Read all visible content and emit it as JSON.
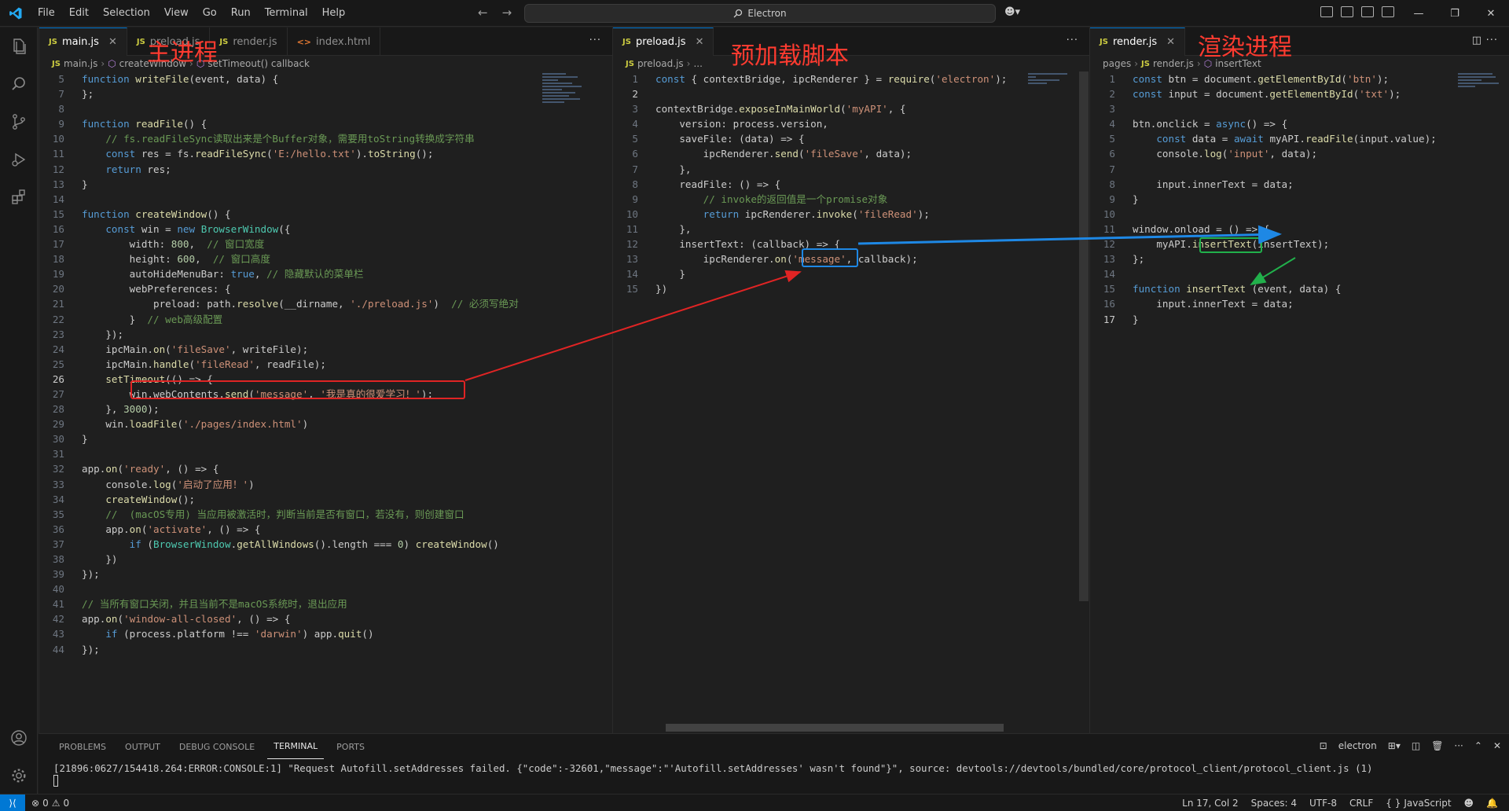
{
  "menu": [
    "File",
    "Edit",
    "Selection",
    "View",
    "Go",
    "Run",
    "Terminal",
    "Help"
  ],
  "search": {
    "text": "Electron"
  },
  "groups": {
    "left": {
      "tabs": [
        "main.js",
        "preload.js",
        "render.js",
        "index.html"
      ],
      "breadcrumb": [
        "main.js",
        "createWindow",
        "setTimeout() callback"
      ],
      "annotation": "主进程"
    },
    "mid": {
      "tabs": [
        "preload.js"
      ],
      "breadcrumb": [
        "preload.js",
        "..."
      ],
      "annotation": "预加载脚本"
    },
    "right": {
      "tabs": [
        "render.js"
      ],
      "breadcrumb": [
        "pages",
        "render.js",
        "insertText"
      ],
      "annotation": "渲染进程"
    }
  },
  "code": {
    "main": [
      {
        "n": 5,
        "t": "function writeFile(event, data) {"
      },
      {
        "n": 7,
        "t": "};"
      },
      {
        "n": 8,
        "t": ""
      },
      {
        "n": 9,
        "t": "function readFile() {"
      },
      {
        "n": 10,
        "t": "    // fs.readFileSync读取出来是个Buffer对象，需要用toString转换成字符串"
      },
      {
        "n": 11,
        "t": "    const res = fs.readFileSync('E:/hello.txt').toString();"
      },
      {
        "n": 12,
        "t": "    return res;"
      },
      {
        "n": 13,
        "t": "}"
      },
      {
        "n": 14,
        "t": ""
      },
      {
        "n": 15,
        "t": "function createWindow() {"
      },
      {
        "n": 16,
        "t": "    const win = new BrowserWindow({"
      },
      {
        "n": 17,
        "t": "        width: 800,  // 窗口宽度"
      },
      {
        "n": 18,
        "t": "        height: 600,  // 窗口高度"
      },
      {
        "n": 19,
        "t": "        autoHideMenuBar: true, // 隐藏默认的菜单栏"
      },
      {
        "n": 20,
        "t": "        webPreferences: {"
      },
      {
        "n": 21,
        "t": "            preload: path.resolve(__dirname, './preload.js')  // 必须写绝对"
      },
      {
        "n": 22,
        "t": "        }  // web高级配置"
      },
      {
        "n": 23,
        "t": "    });"
      },
      {
        "n": 24,
        "t": "    ipcMain.on('fileSave', writeFile);"
      },
      {
        "n": 25,
        "t": "    ipcMain.handle('fileRead', readFile);"
      },
      {
        "n": 26,
        "t": "    setTimeout(() => {"
      },
      {
        "n": 27,
        "t": "        win.webContents.send('message', '我是真的很爱学习！');"
      },
      {
        "n": 28,
        "t": "    }, 3000);"
      },
      {
        "n": 29,
        "t": "    win.loadFile('./pages/index.html')"
      },
      {
        "n": 30,
        "t": "}"
      },
      {
        "n": 31,
        "t": ""
      },
      {
        "n": 32,
        "t": "app.on('ready', () => {"
      },
      {
        "n": 33,
        "t": "    console.log('启动了应用！')"
      },
      {
        "n": 34,
        "t": "    createWindow();"
      },
      {
        "n": 35,
        "t": "    //  (macOS专用) 当应用被激活时，判断当前是否有窗口，若没有，则创建窗口"
      },
      {
        "n": 36,
        "t": "    app.on('activate', () => {"
      },
      {
        "n": 37,
        "t": "        if (BrowserWindow.getAllWindows().length === 0) createWindow()"
      },
      {
        "n": 38,
        "t": "    })"
      },
      {
        "n": 39,
        "t": "});"
      },
      {
        "n": 40,
        "t": ""
      },
      {
        "n": 41,
        "t": "// 当所有窗口关闭，并且当前不是macOS系统时，退出应用"
      },
      {
        "n": 42,
        "t": "app.on('window-all-closed', () => {"
      },
      {
        "n": 43,
        "t": "    if (process.platform !== 'darwin') app.quit()"
      },
      {
        "n": 44,
        "t": "});"
      }
    ],
    "preload": [
      {
        "n": 1,
        "t": "const { contextBridge, ipcRenderer } = require('electron');"
      },
      {
        "n": 2,
        "t": ""
      },
      {
        "n": 3,
        "t": "contextBridge.exposeInMainWorld('myAPI', {"
      },
      {
        "n": 4,
        "t": "    version: process.version,"
      },
      {
        "n": 5,
        "t": "    saveFile: (data) => {"
      },
      {
        "n": 6,
        "t": "        ipcRenderer.send('fileSave', data);"
      },
      {
        "n": 7,
        "t": "    },"
      },
      {
        "n": 8,
        "t": "    readFile: () => {"
      },
      {
        "n": 9,
        "t": "        // invoke的返回值是一个promise对象"
      },
      {
        "n": 10,
        "t": "        return ipcRenderer.invoke('fileRead');"
      },
      {
        "n": 11,
        "t": "    },"
      },
      {
        "n": 12,
        "t": "    insertText: (callback) => {"
      },
      {
        "n": 13,
        "t": "        ipcRenderer.on('message', callback);"
      },
      {
        "n": 14,
        "t": "    }"
      },
      {
        "n": 15,
        "t": "})"
      }
    ],
    "render": [
      {
        "n": 1,
        "t": "const btn = document.getElementById('btn');"
      },
      {
        "n": 2,
        "t": "const input = document.getElementById('txt');"
      },
      {
        "n": 3,
        "t": ""
      },
      {
        "n": 4,
        "t": "btn.onclick = async() => {"
      },
      {
        "n": 5,
        "t": "    const data = await myAPI.readFile(input.value);"
      },
      {
        "n": 6,
        "t": "    console.log('input', data);"
      },
      {
        "n": 7,
        "t": ""
      },
      {
        "n": 8,
        "t": "    input.innerText = data;"
      },
      {
        "n": 9,
        "t": "}"
      },
      {
        "n": 10,
        "t": ""
      },
      {
        "n": 11,
        "t": "window.onload = () => {"
      },
      {
        "n": 12,
        "t": "    myAPI.insertText(insertText);"
      },
      {
        "n": 13,
        "t": "};"
      },
      {
        "n": 14,
        "t": ""
      },
      {
        "n": 15,
        "t": "function insertText (event, data) {"
      },
      {
        "n": 16,
        "t": "    input.innerText = data;"
      },
      {
        "n": 17,
        "t": "}"
      }
    ]
  },
  "panel": {
    "tabs": [
      "PROBLEMS",
      "OUTPUT",
      "DEBUG CONSOLE",
      "TERMINAL",
      "PORTS"
    ],
    "active_tab": "TERMINAL",
    "terminal_name": "electron",
    "terminal_output": "[21896:0627/154418.264:ERROR:CONSOLE:1] \"Request Autofill.setAddresses failed. {\"code\":-32601,\"message\":\"'Autofill.setAddresses' wasn't found\"}\", source: devtools://devtools/bundled/core/protocol_client/protocol_client.js (1)"
  },
  "status": {
    "errors": "0",
    "warnings": "0",
    "position": "Ln 17, Col 2",
    "spaces": "Spaces: 4",
    "encoding": "UTF-8",
    "eol": "CRLF",
    "language": "JavaScript",
    "language_icon": "{ }"
  },
  "colors": {
    "accent": "#0078d4",
    "annotation_red": "#ff3b30",
    "box_red": "#e02424",
    "box_blue": "#1e88e5",
    "box_green": "#21b04b"
  }
}
